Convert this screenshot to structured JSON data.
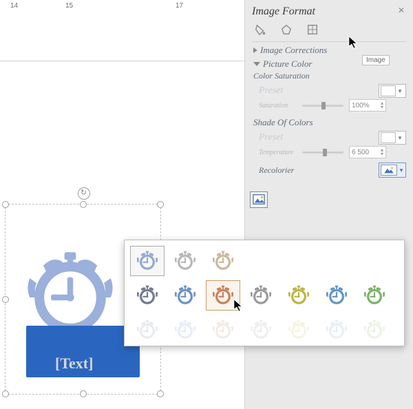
{
  "ruler": {
    "ticks": [
      "14",
      "15",
      "",
      "17"
    ],
    "tick_positions": [
      15,
      95,
      175,
      255
    ]
  },
  "canvas": {
    "text_placeholder": "[Text]"
  },
  "panel": {
    "title": "Image Format",
    "close": "✕",
    "tabs": {
      "fill": "fill-icon",
      "shape": "shape-icon",
      "size": "size-icon",
      "picture": "picture-icon",
      "tooltip": "Image"
    },
    "corrections": {
      "label": "Image Corrections"
    },
    "picture_color": {
      "label": "Picture Color",
      "saturation_label": "Color Saturation",
      "preset_label": "Preset",
      "saturation_row": {
        "label": "Saturation",
        "value": "100%"
      },
      "shade_label": "Shade Of Colors",
      "preset2_label": "Preset",
      "temp_row": {
        "label": "Temperature",
        "value": "6 500"
      },
      "recolor_label": "Recolorier"
    }
  },
  "flyout": {
    "rows": [
      {
        "count": 3,
        "selected": 0,
        "colors": [
          "#94a9d0",
          "#b7b7b7",
          "#c9b89b"
        ]
      },
      {
        "count": 7,
        "hover": 2,
        "colors": [
          "#6f7b90",
          "#6b91c4",
          "#c9825c",
          "#9a9a9a",
          "#bcb443",
          "#6495c4",
          "#7cb26a"
        ]
      },
      {
        "count": 7,
        "colors": [
          "#d6dbe5",
          "#d3dff0",
          "#eadacd",
          "#e1e1e1",
          "#ecebcf",
          "#d5e3ef",
          "#dcead3"
        ]
      }
    ]
  }
}
